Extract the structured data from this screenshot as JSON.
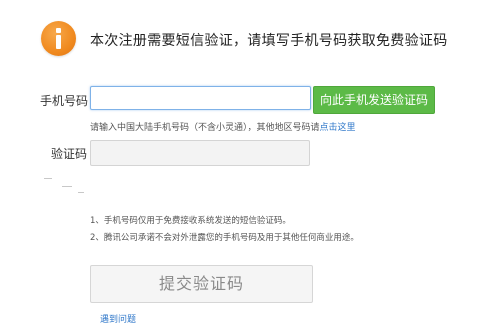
{
  "header": {
    "icon": "info-icon",
    "icon_color": "#f08a1f",
    "title": "本次注册需要短信验证，请填写手机号码获取免费验证码"
  },
  "form": {
    "phone": {
      "label": "手机号码",
      "value": "",
      "placeholder": ""
    },
    "send_button": {
      "label": "向此手机发送验证码",
      "color": "#5cba47"
    },
    "hint": {
      "text": "请输入中国大陆手机号码（不含小灵通），其他地区号码请",
      "link": "点击这里"
    },
    "code": {
      "label": "验证码",
      "value": "",
      "placeholder": ""
    }
  },
  "notes": [
    "1、手机号码仅用于免费接收系统发送的短信验证码。",
    "2、腾讯公司承诺不会对外泄露您的手机号码及用于其他任何商业用途。"
  ],
  "submit_button": {
    "label": "提交验证码"
  },
  "help_link": {
    "label": "遇到问题"
  },
  "colors": {
    "link": "#2f77c9",
    "input_focus_border": "#7fb2e8"
  }
}
